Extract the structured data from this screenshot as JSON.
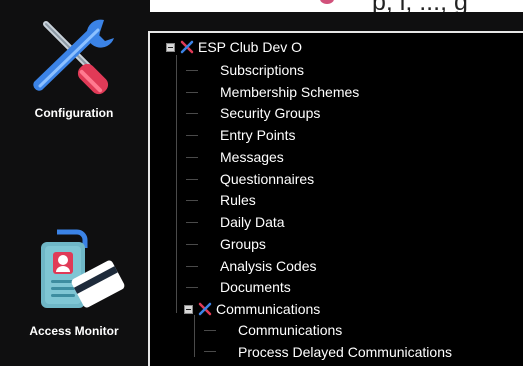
{
  "sidebar": {
    "modules": [
      {
        "label": "Configuration",
        "icon": "wrench-screwdriver-icon"
      },
      {
        "label": "Access Monitor",
        "icon": "id-badge-card-icon"
      }
    ]
  },
  "tree": {
    "root": {
      "label": "ESP Club Dev O",
      "icon": "tools-icon"
    },
    "items": [
      {
        "label": "Subscriptions"
      },
      {
        "label": "Membership Schemes"
      },
      {
        "label": "Security Groups"
      },
      {
        "label": "Entry Points"
      },
      {
        "label": "Messages"
      },
      {
        "label": "Questionnaires"
      },
      {
        "label": "Rules"
      },
      {
        "label": "Daily Data"
      },
      {
        "label": "Groups"
      },
      {
        "label": "Analysis Codes"
      },
      {
        "label": "Documents"
      }
    ],
    "communications": {
      "label": "Communications",
      "icon": "tools-icon",
      "children": [
        {
          "label": "Communications"
        },
        {
          "label": "Process Delayed Communications"
        }
      ]
    }
  },
  "top_strip": {
    "text": "p, i, ..., g"
  },
  "colors": {
    "background": "#0f0f10",
    "panel": "#000000",
    "panel_border": "#e6e6e6",
    "accent_red": "#e03a57",
    "accent_blue": "#2f6fd6"
  }
}
